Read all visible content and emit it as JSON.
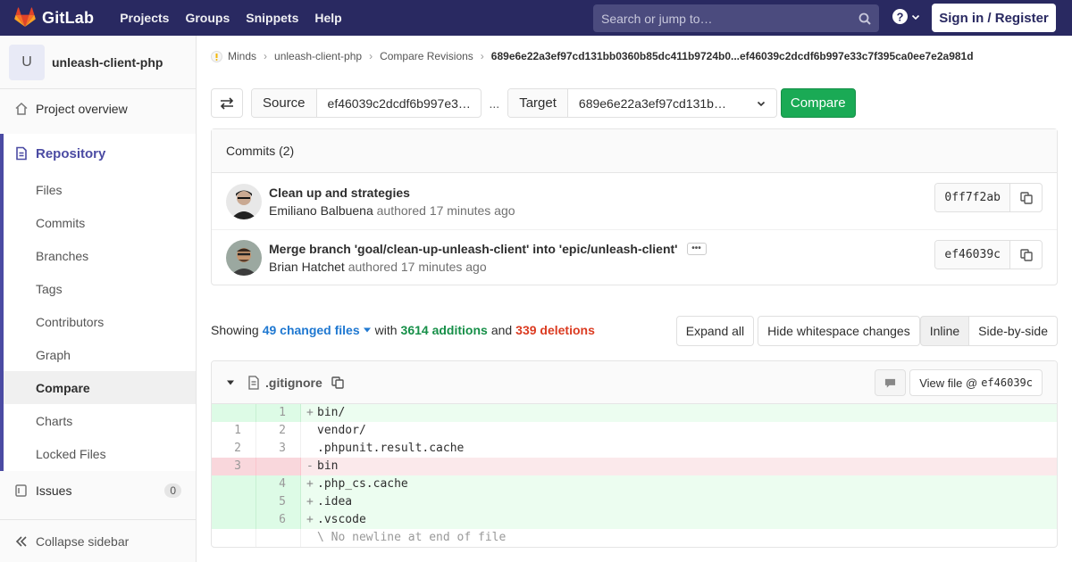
{
  "nav": {
    "brand": "GitLab",
    "links": [
      "Projects",
      "Groups",
      "Snippets",
      "Help"
    ],
    "search_placeholder": "Search or jump to…",
    "signin": "Sign in / Register"
  },
  "sidebar": {
    "project_initial": "U",
    "project_name": "unleash-client-php",
    "overview": "Project overview",
    "repository": "Repository",
    "repo_items": [
      "Files",
      "Commits",
      "Branches",
      "Tags",
      "Contributors",
      "Graph",
      "Compare",
      "Charts",
      "Locked Files"
    ],
    "active_item": "Compare",
    "issues": "Issues",
    "issues_count": "0",
    "collapse": "Collapse sidebar"
  },
  "breadcrumb": {
    "items": [
      "Minds",
      "unleash-client-php",
      "Compare Revisions"
    ],
    "current": "689e6e22a3ef97cd131bb0360b85dc411b9724b0...ef46039c2dcdf6b997e33c7f395ca0ee7e2a981d"
  },
  "compare": {
    "source_label": "Source",
    "source_value": "ef46039c2dcdf6b997e3…",
    "separator": "...",
    "target_label": "Target",
    "target_value": "689e6e22a3ef97cd131b…",
    "button": "Compare"
  },
  "commits": {
    "header": "Commits (2)",
    "items": [
      {
        "title": "Clean up and strategies",
        "author": "Emiliano Balbuena",
        "action": "authored",
        "time": "17 minutes ago",
        "sha": "0ff7f2ab"
      },
      {
        "title": "Merge branch 'goal/clean-up-unleash-client' into 'epic/unleash-client'",
        "author": "Brian Hatchet",
        "action": "authored",
        "time": "17 minutes ago",
        "sha": "ef46039c"
      }
    ]
  },
  "stats": {
    "showing": "Showing",
    "changed": "49 changed files",
    "with": "with",
    "additions": "3614 additions",
    "and": "and",
    "deletions": "339 deletions"
  },
  "view_buttons": {
    "expand": "Expand all",
    "whitespace": "Hide whitespace changes",
    "inline": "Inline",
    "side": "Side-by-side"
  },
  "file": {
    "name": ".gitignore",
    "view_file": "View file @",
    "view_sha": "ef46039c",
    "lines": [
      {
        "type": "add",
        "old": "",
        "new": "1",
        "marker": "+",
        "text": "bin/"
      },
      {
        "type": "ctx",
        "old": "1",
        "new": "2",
        "marker": " ",
        "text": "vendor/"
      },
      {
        "type": "ctx",
        "old": "2",
        "new": "3",
        "marker": " ",
        "text": ".phpunit.result.cache"
      },
      {
        "type": "del",
        "old": "3",
        "new": "",
        "marker": "-",
        "text": "bin"
      },
      {
        "type": "add",
        "old": "",
        "new": "4",
        "marker": "+",
        "text": ".php_cs.cache"
      },
      {
        "type": "add",
        "old": "",
        "new": "5",
        "marker": "+",
        "text": ".idea"
      },
      {
        "type": "add",
        "old": "",
        "new": "6",
        "marker": "+",
        "text": ".vscode"
      },
      {
        "type": "meta",
        "old": "",
        "new": "",
        "marker": " ",
        "text": "\\ No newline at end of file"
      }
    ]
  },
  "colors": {
    "nav_bg": "#292961",
    "accent": "#4b4ba3",
    "green": "#1aaa55",
    "link": "#1f78d1",
    "red": "#db3b21"
  }
}
